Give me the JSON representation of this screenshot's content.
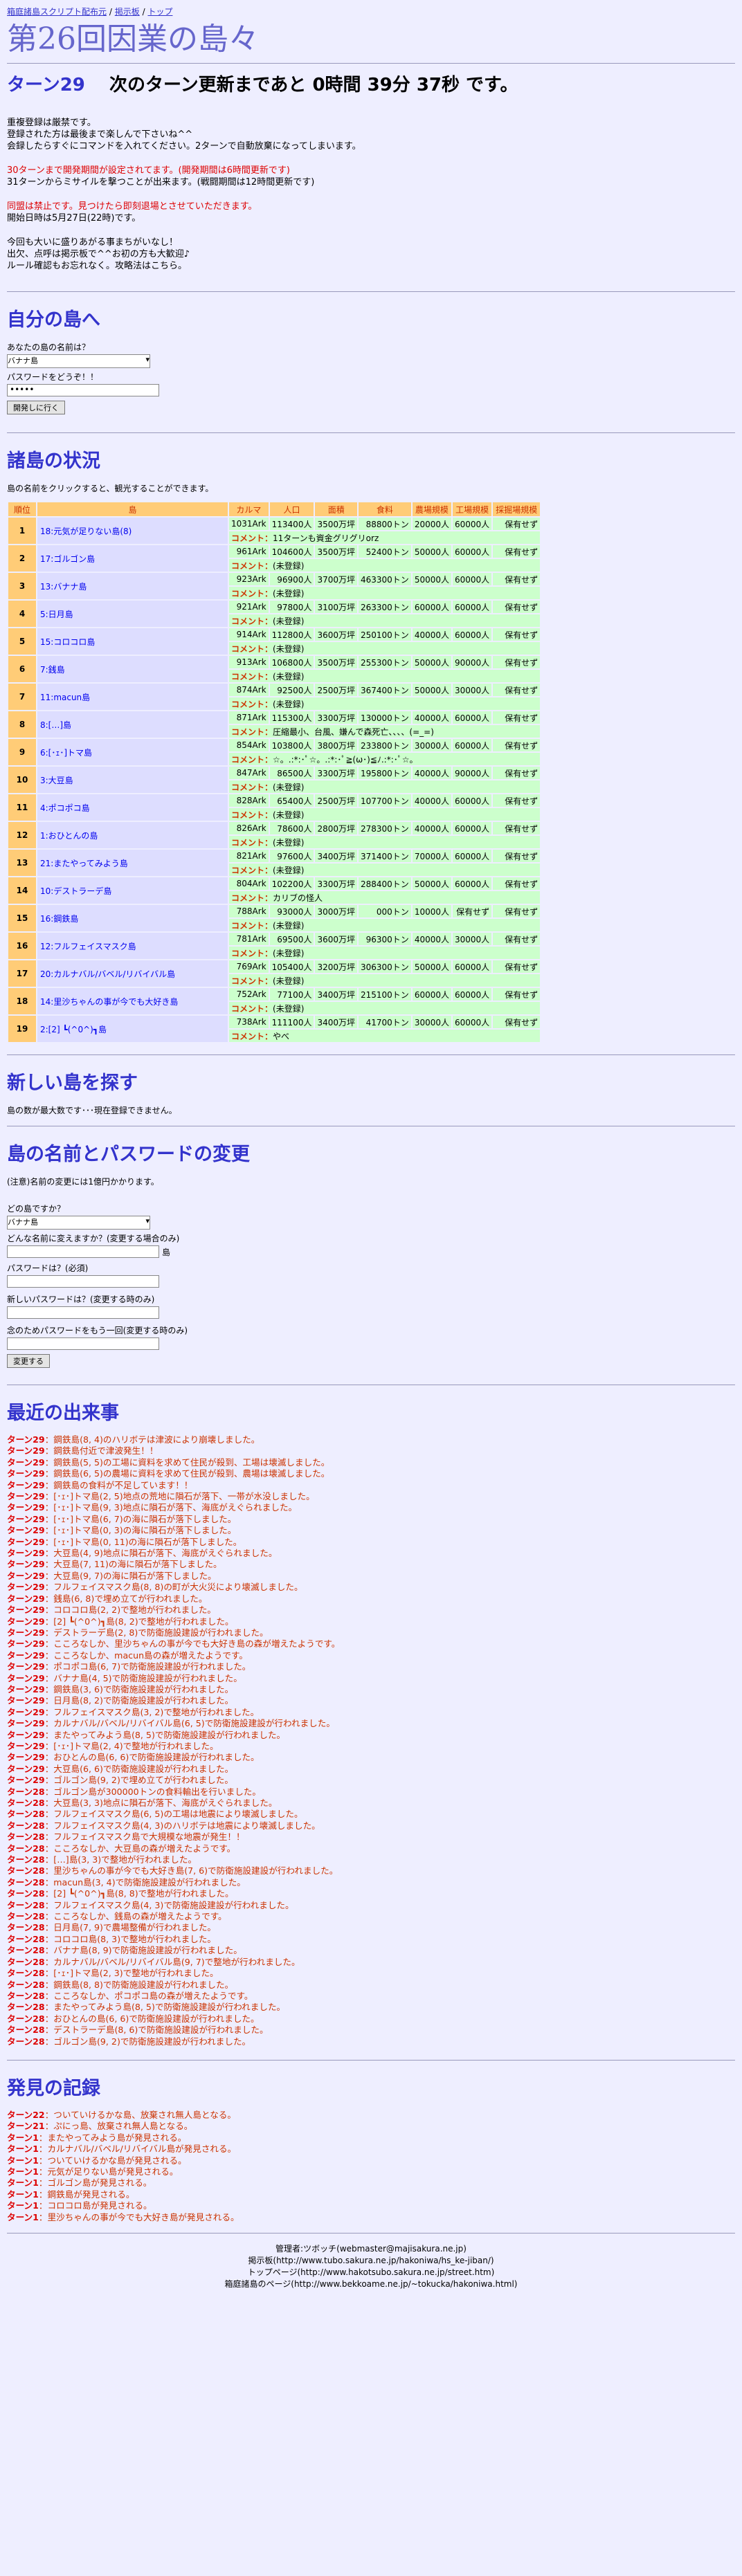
{
  "top_links": [
    "箱庭諸島スクリプト配布元",
    "掲示板",
    "トップ"
  ],
  "site_title": "第26回因業の島々",
  "turn": {
    "label": "ターン29",
    "status": "次のターン更新まであと 0時間 39分 37秒 です。"
  },
  "notices": [
    "重複登録は厳禁です。",
    "登録された方は最後まで楽しんで下さいね^^",
    "会録したらすぐにコマンドを入れてください。2ターンで自動放棄になってしまいます。",
    "",
    "30ターンまで開発期間が設定されてます。(開発期間は6時間更新です)",
    "31ターンからミサイルを撃つことが出来ます。(戦闘期間は12時間更新です)",
    "",
    "同盟は禁止です。見つけたら即刻退場とさせていただきます。",
    "開始日時は5月27日(22時)です。",
    "",
    "今回も大いに盛りあがる事まちがいなし！",
    "出欠、点呼は掲示板で^^お初の方も大歓迎♪",
    "ルール確認もお忘れなく。攻略法はこちら。"
  ],
  "my_island": {
    "heading": "自分の島へ",
    "question": "あなたの島の名前は？",
    "selected": "バナナ島",
    "password_label": "パスワードをどうぞ！！",
    "password_value": "•••••",
    "button": "開発しに行く"
  },
  "islands_section": {
    "heading": "諸島の状況",
    "note": "島の名前をクリックすると、観光することができます。",
    "columns": [
      "順位",
      "島",
      "カルマ",
      "人口",
      "面積",
      "食料",
      "農場規模",
      "工場規模",
      "採掘場規模"
    ],
    "comment_label": "コメント：",
    "rows": [
      {
        "rank": "1",
        "name": "18:元気が足りない島(8)",
        "karma": "1031Ark",
        "pop": "113400人",
        "area": "3500万坪",
        "food": "88800トン",
        "farm": "20000人",
        "factory": "60000人",
        "mine": "保有せず",
        "comment": "11ターンも資金グリグリorz"
      },
      {
        "rank": "2",
        "name": "17:ゴルゴン島",
        "karma": "961Ark",
        "pop": "104600人",
        "area": "3500万坪",
        "food": "52400トン",
        "farm": "50000人",
        "factory": "60000人",
        "mine": "保有せず",
        "comment": "(未登録)"
      },
      {
        "rank": "3",
        "name": "13:バナナ島",
        "karma": "923Ark",
        "pop": "96900人",
        "area": "3700万坪",
        "food": "463300トン",
        "farm": "50000人",
        "factory": "60000人",
        "mine": "保有せず",
        "comment": "(未登録)"
      },
      {
        "rank": "4",
        "name": "5:日月島",
        "karma": "921Ark",
        "pop": "97800人",
        "area": "3100万坪",
        "food": "263300トン",
        "farm": "60000人",
        "factory": "60000人",
        "mine": "保有せず",
        "comment": "(未登録)"
      },
      {
        "rank": "5",
        "name": "15:コロコロ島",
        "karma": "914Ark",
        "pop": "112800人",
        "area": "3600万坪",
        "food": "250100トン",
        "farm": "40000人",
        "factory": "60000人",
        "mine": "保有せず",
        "comment": "(未登録)"
      },
      {
        "rank": "6",
        "name": "7:銭島",
        "karma": "913Ark",
        "pop": "106800人",
        "area": "3500万坪",
        "food": "255300トン",
        "farm": "50000人",
        "factory": "90000人",
        "mine": "保有せず",
        "comment": "(未登録)"
      },
      {
        "rank": "7",
        "name": "11:macun島",
        "karma": "874Ark",
        "pop": "92500人",
        "area": "2500万坪",
        "food": "367400トン",
        "farm": "50000人",
        "factory": "30000人",
        "mine": "保有せず",
        "comment": "(未登録)"
      },
      {
        "rank": "8",
        "name": "8:[…]島",
        "karma": "871Ark",
        "pop": "115300人",
        "area": "3300万坪",
        "food": "130000トン",
        "farm": "40000人",
        "factory": "60000人",
        "mine": "保有せず",
        "comment": "圧縮最小、台風、嫌んで森死亡、、、、(=_=)"
      },
      {
        "rank": "9",
        "name": "6:[･ｪ･]トマ島",
        "karma": "854Ark",
        "pop": "103800人",
        "area": "3800万坪",
        "food": "233800トン",
        "farm": "30000人",
        "factory": "60000人",
        "mine": "保有せず",
        "comment": "☆。.:*:･ﾟ☆。.:*:･ﾟ≧(ω･)≦ﾉ.:*:･ﾟ☆。"
      },
      {
        "rank": "10",
        "name": "3:大豆島",
        "karma": "847Ark",
        "pop": "86500人",
        "area": "3300万坪",
        "food": "195800トン",
        "farm": "40000人",
        "factory": "90000人",
        "mine": "保有せず",
        "comment": "(未登録)"
      },
      {
        "rank": "11",
        "name": "4:ポコポコ島",
        "karma": "828Ark",
        "pop": "65400人",
        "area": "2500万坪",
        "food": "107700トン",
        "farm": "40000人",
        "factory": "60000人",
        "mine": "保有せず",
        "comment": "(未登録)"
      },
      {
        "rank": "12",
        "name": "1:おひとんの島",
        "karma": "826Ark",
        "pop": "78600人",
        "area": "2800万坪",
        "food": "278300トン",
        "farm": "40000人",
        "factory": "60000人",
        "mine": "保有せず",
        "comment": "(未登録)"
      },
      {
        "rank": "13",
        "name": "21:またやってみよう島",
        "karma": "821Ark",
        "pop": "97600人",
        "area": "3400万坪",
        "food": "371400トン",
        "farm": "70000人",
        "factory": "60000人",
        "mine": "保有せず",
        "comment": "(未登録)"
      },
      {
        "rank": "14",
        "name": "10:デストラーデ島",
        "karma": "804Ark",
        "pop": "102200人",
        "area": "3300万坪",
        "food": "288400トン",
        "farm": "50000人",
        "factory": "60000人",
        "mine": "保有せず",
        "comment": "カリブの怪人"
      },
      {
        "rank": "15",
        "name": "16:鋼鉄島",
        "karma": "788Ark",
        "pop": "93000人",
        "area": "3000万坪",
        "food": "000トン",
        "farm": "10000人",
        "factory": "保有せず",
        "mine": "保有せず",
        "comment": "(未登録)"
      },
      {
        "rank": "16",
        "name": "12:フルフェイスマスク島",
        "karma": "781Ark",
        "pop": "69500人",
        "area": "3600万坪",
        "food": "96300トン",
        "farm": "40000人",
        "factory": "30000人",
        "mine": "保有せず",
        "comment": "(未登録)"
      },
      {
        "rank": "17",
        "name": "20:カルナバル/バベル/リバイバル島",
        "karma": "769Ark",
        "pop": "105400人",
        "area": "3200万坪",
        "food": "306300トン",
        "farm": "50000人",
        "factory": "60000人",
        "mine": "保有せず",
        "comment": "(未登録)"
      },
      {
        "rank": "18",
        "name": "14:里沙ちゃんの事が今でも大好き島",
        "karma": "752Ark",
        "pop": "77100人",
        "area": "3400万坪",
        "food": "215100トン",
        "farm": "60000人",
        "factory": "60000人",
        "mine": "保有せず",
        "comment": "(未登録)"
      },
      {
        "rank": "19",
        "name": "2:[2] ┗(^0^)┓島",
        "karma": "738Ark",
        "pop": "111100人",
        "area": "3400万坪",
        "food": "41700トン",
        "farm": "30000人",
        "factory": "60000人",
        "mine": "保有せず",
        "comment": "やべ"
      }
    ]
  },
  "new_island": {
    "heading": "新しい島を探す",
    "text": "島の数が最大数です･･･現在登録できません。"
  },
  "change_section": {
    "heading": "島の名前とパスワードの変更",
    "note": "(注意)名前の変更には1億円かかります。",
    "which_label": "どの島ですか？",
    "selected": "バナナ島",
    "newname_label": "どんな名前に変えますか？(変更する場合のみ)",
    "suffix": "島",
    "password_label": "パスワードは？(必須)",
    "newpass_label": "新しいパスワードは？(変更する時のみ)",
    "confirm_label": "念のためパスワードをもう一回(変更する時のみ)",
    "button": "変更する"
  },
  "events": {
    "heading": "最近の出来事",
    "items": [
      [
        "ターン29",
        "：鋼鉄島(8, 4)のハリボテは津波により崩壊しました。"
      ],
      [
        "ターン29",
        "：鋼鉄島付近で津波発生！！"
      ],
      [
        "ターン29",
        "：鋼鉄島(5, 5)の工場に資料を求めて住民が殺到、工場は壊滅しました。"
      ],
      [
        "ターン29",
        "：鋼鉄島(6, 5)の農場に資料を求めて住民が殺到、農場は壊滅しました。"
      ],
      [
        "ターン29",
        "：鋼鉄島の食料が不足しています！！"
      ],
      [
        "ターン29",
        "：[･ｪ･]トマ島(2, 5)地点の荒地に隕石が落下、一帯が水没しました。"
      ],
      [
        "ターン29",
        "：[･ｪ･]トマ島(9, 3)地点に隕石が落下、海底がえぐられました。"
      ],
      [
        "ターン29",
        "：[･ｪ･]トマ島(6, 7)の海に隕石が落下しました。"
      ],
      [
        "ターン29",
        "：[･ｪ･]トマ島(0, 3)の海に隕石が落下しました。"
      ],
      [
        "ターン29",
        "：[･ｪ･]トマ島(0, 11)の海に隕石が落下しました。"
      ],
      [
        "ターン29",
        "：大豆島(4, 9)地点に隕石が落下、海底がえぐられました。"
      ],
      [
        "ターン29",
        "：大豆島(7, 11)の海に隕石が落下しました。"
      ],
      [
        "ターン29",
        "：大豆島(9, 7)の海に隕石が落下しました。"
      ],
      [
        "ターン29",
        "：フルフェイスマスク島(8, 8)の町が大火災により壊滅しました。"
      ],
      [
        "ターン29",
        "：銭島(6, 8)で埋め立てが行われました。"
      ],
      [
        "ターン29",
        "：コロコロ島(2, 2)で整地が行われました。"
      ],
      [
        "ターン29",
        "：[2] ┗(^0^)┓島(8, 2)で整地が行われました。"
      ],
      [
        "ターン29",
        "：デストラーデ島(2, 8)で防衛施設建設が行われました。"
      ],
      [
        "ターン29",
        "：こころなしか、里沙ちゃんの事が今でも大好き島の森が増えたようです。"
      ],
      [
        "ターン29",
        "：こころなしか、macun島の森が増えたようです。"
      ],
      [
        "ターン29",
        "：ポコポコ島(6, 7)で防衛施設建設が行われました。"
      ],
      [
        "ターン29",
        "：バナナ島(4, 5)で防衛施設建設が行われました。"
      ],
      [
        "ターン29",
        "：鋼鉄島(3, 6)で防衛施設建設が行われました。"
      ],
      [
        "ターン29",
        "：日月島(8, 2)で防衛施設建設が行われました。"
      ],
      [
        "ターン29",
        "：フルフェイスマスク島(3, 2)で整地が行われました。"
      ],
      [
        "ターン29",
        "：カルナバル/バベル/リバイバル島(6, 5)で防衛施設建設が行われました。"
      ],
      [
        "ターン29",
        "：またやってみよう島(8, 5)で防衛施設建設が行われました。"
      ],
      [
        "ターン29",
        "：[･ｪ･]トマ島(2, 4)で整地が行われました。"
      ],
      [
        "ターン29",
        "：おひとんの島(6, 6)で防衛施設建設が行われました。"
      ],
      [
        "ターン29",
        "：大豆島(6, 6)で防衛施設建設が行われました。"
      ],
      [
        "ターン29",
        "：ゴルゴン島(9, 2)で埋め立てが行われました。"
      ],
      [
        "ターン28",
        "：ゴルゴン島が300000トンの食料輸出を行いました。"
      ],
      [
        "ターン28",
        "：大豆島(3, 3)地点に隕石が落下、海底がえぐられました。"
      ],
      [
        "ターン28",
        "：フルフェイスマスク島(6, 5)の工場は地震により壊滅しました。"
      ],
      [
        "ターン28",
        "：フルフェイスマスク島(4, 3)のハリボテは地震により壊滅しました。"
      ],
      [
        "ターン28",
        "：フルフェイスマスク島で大規模な地震が発生！！"
      ],
      [
        "ターン28",
        "：こころなしか、大豆島の森が増えたようです。"
      ],
      [
        "ターン28",
        "：[…]島(3, 3)で整地が行われました。"
      ],
      [
        "ターン28",
        "：里沙ちゃんの事が今でも大好き島(7, 6)で防衛施設建設が行われました。"
      ],
      [
        "ターン28",
        "：macun島(3, 4)で防衛施設建設が行われました。"
      ],
      [
        "ターン28",
        "：[2] ┗(^0^)┓島(8, 8)で整地が行われました。"
      ],
      [
        "ターン28",
        "：フルフェイスマスク島(4, 3)で防衛施設建設が行われました。"
      ],
      [
        "ターン28",
        "：こころなしか、銭島の森が増えたようです。"
      ],
      [
        "ターン28",
        "：日月島(7, 9)で農場整備が行われました。"
      ],
      [
        "ターン28",
        "：コロコロ島(8, 3)で整地が行われました。"
      ],
      [
        "ターン28",
        "：バナナ島(8, 9)で防衛施設建設が行われました。"
      ],
      [
        "ターン28",
        "：カルナバル/バベル/リバイバル島(9, 7)で整地が行われました。"
      ],
      [
        "ターン28",
        "：[･ｪ･]トマ島(2, 3)で整地が行われました。"
      ],
      [
        "ターン28",
        "：鋼鉄島(8, 8)で防衛施設建設が行われました。"
      ],
      [
        "ターン28",
        "：こころなしか、ポコポコ島の森が増えたようです。"
      ],
      [
        "ターン28",
        "：またやってみよう島(8, 5)で防衛施設建設が行われました。"
      ],
      [
        "ターン28",
        "：おひとんの島(6, 6)で防衛施設建設が行われました。"
      ],
      [
        "ターン28",
        "：デストラーデ島(8, 6)で防衛施設建設が行われました。"
      ],
      [
        "ターン28",
        "：ゴルゴン島(9, 2)で防衛施設建設が行われました。"
      ]
    ]
  },
  "discovery": {
    "heading": "発見の記録",
    "items": [
      [
        "ターン22",
        "：ついていけるかな島、放棄され無人島となる。"
      ],
      [
        "ターン21",
        "：ぷにっ島、放棄され無人島となる。"
      ],
      [
        "ターン1",
        "：またやってみよう島が発見される。"
      ],
      [
        "ターン1",
        "：カルナバル/バベル/リバイバル島が発見される。"
      ],
      [
        "ターン1",
        "：ついていけるかな島が発見される。"
      ],
      [
        "ターン1",
        "：元気が足りない島が発見される。"
      ],
      [
        "ターン1",
        "：ゴルゴン島が発見される。"
      ],
      [
        "ターン1",
        "：鋼鉄島が発見される。"
      ],
      [
        "ターン1",
        "：コロコロ島が発見される。"
      ],
      [
        "ターン1",
        "：里沙ちゃんの事が今でも大好き島が発見される。"
      ]
    ]
  },
  "footer": {
    "admin": "管理者:ツボッチ(webmaster@majisakura.ne.jp)",
    "bbs": "掲示板(http://www.tubo.sakura.ne.jp/hakoniwa/hs_ke-jiban/)",
    "top": "トップページ(http://www.hakotsubo.sakura.ne.jp/street.htm)",
    "hakoniwa": "箱庭諸島のページ(http://www.bekkoame.ne.jp/~tokucka/hakoniwa.html)"
  },
  "colors": {
    "heading": "#3333cc",
    "alert": "#dd0000",
    "header_cell": "#ffcc77",
    "data_cell": "#ccffcc",
    "name_cell": "#ddddff",
    "background": "#eeeeff"
  }
}
